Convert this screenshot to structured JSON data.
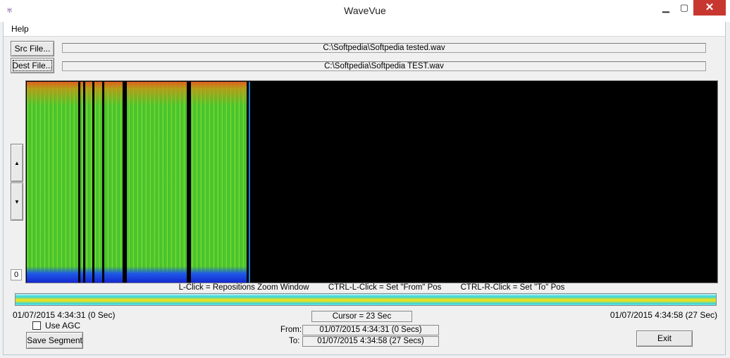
{
  "window": {
    "title": "WaveVue",
    "icon": "tuning-fork-icon",
    "minimize_glyph": "▁",
    "maximize_glyph": "▢",
    "close_glyph": "✕"
  },
  "menu": {
    "help": "Help"
  },
  "files": {
    "src_button": "Src File...",
    "src_path": "C:\\Softpedia\\Softpedia tested.wav",
    "dest_button": "Dest File...",
    "dest_path": "C:\\Softpedia\\Softpedia TEST.wav"
  },
  "zoom": {
    "up_glyph": "▲",
    "down_glyph": "▼",
    "level": "0"
  },
  "hints": {
    "left_click": "L-Click = Repositions Zoom Window",
    "ctrl_left_click": "CTRL-L-Click = Set \"From\" Pos",
    "ctrl_right_click": "CTRL-R-Click = Set \"To\" Pos"
  },
  "timeline": {
    "start": "01/07/2015 4:34:31 (0 Sec)",
    "end": "01/07/2015 4:34:58 (27 Sec)",
    "cursor": "Cursor = 23 Sec"
  },
  "options": {
    "use_agc": "Use AGC",
    "use_agc_checked": false
  },
  "segment": {
    "save_button": "Save Segment",
    "from_label": "From:",
    "from_value": "01/07/2015 4:34:31 (0 Secs)",
    "to_label": "To:",
    "to_value": "01/07/2015 4:34:58 (27 Secs)"
  },
  "exit_button": "Exit",
  "colors": {
    "spectrum_green": "#48c02a",
    "spectrum_hot": "#e65a1e",
    "spectrum_low": "#1e5ae6",
    "close_red": "#c7372f"
  }
}
